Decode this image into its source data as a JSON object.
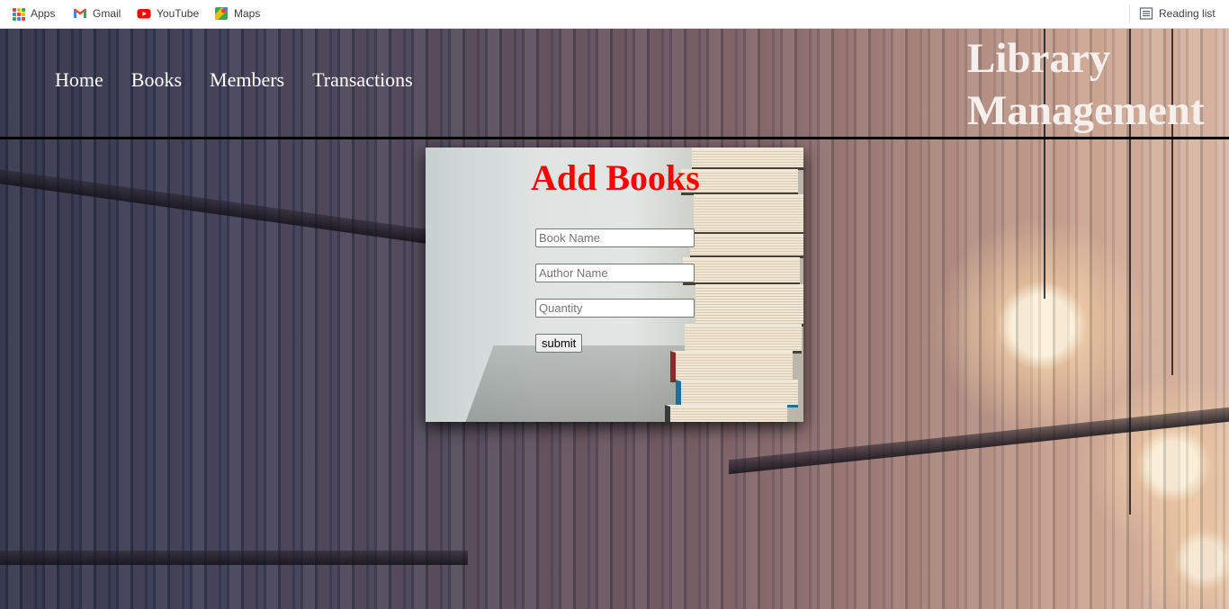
{
  "bookmarks_bar": {
    "items": [
      {
        "label": "Apps",
        "icon": "apps-grid-icon"
      },
      {
        "label": "Gmail",
        "icon": "gmail-icon"
      },
      {
        "label": "YouTube",
        "icon": "youtube-icon"
      },
      {
        "label": "Maps",
        "icon": "maps-icon"
      }
    ],
    "reading_list": {
      "label": "Reading list",
      "icon": "reading-list-icon"
    }
  },
  "header": {
    "nav": [
      {
        "label": "Home"
      },
      {
        "label": "Books"
      },
      {
        "label": "Members"
      },
      {
        "label": "Transactions"
      }
    ],
    "brand_line1": "Library",
    "brand_line2": "Management"
  },
  "form": {
    "title": "Add Books",
    "title_color": "#ff0000",
    "book_name": {
      "value": "",
      "placeholder": "Book Name"
    },
    "author_name": {
      "value": "",
      "placeholder": "Author Name"
    },
    "quantity": {
      "value": "",
      "placeholder": "Quantity"
    },
    "submit_label": "submit"
  }
}
